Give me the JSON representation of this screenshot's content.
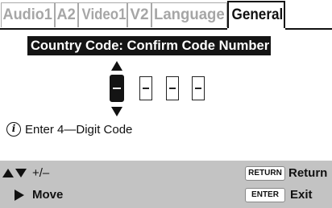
{
  "tabs": [
    {
      "label": "Audio1",
      "active": false
    },
    {
      "label": "A2",
      "active": false
    },
    {
      "label": "Video1",
      "active": false
    },
    {
      "label": "V2",
      "active": false
    },
    {
      "label": "Language",
      "active": false
    },
    {
      "label": "General",
      "active": true
    }
  ],
  "panel": {
    "title": "Country Code: Confirm Code Number",
    "digits": [
      "–",
      "–",
      "–",
      "–"
    ],
    "active_digit": 1
  },
  "info": {
    "icon": "info-icon",
    "icon_glyph": "i",
    "text": "Enter 4—Digit Code"
  },
  "footer": {
    "adjust_label": "+/–",
    "move_label": "Move",
    "return_key": "RETURN",
    "return_label": "Return",
    "enter_key": "ENTER",
    "exit_label": "Exit"
  },
  "colors": {
    "title_bg": "#141414",
    "bottom_bar": "#c3c3c3",
    "inactive_tab_text": "#a6a6a6"
  }
}
